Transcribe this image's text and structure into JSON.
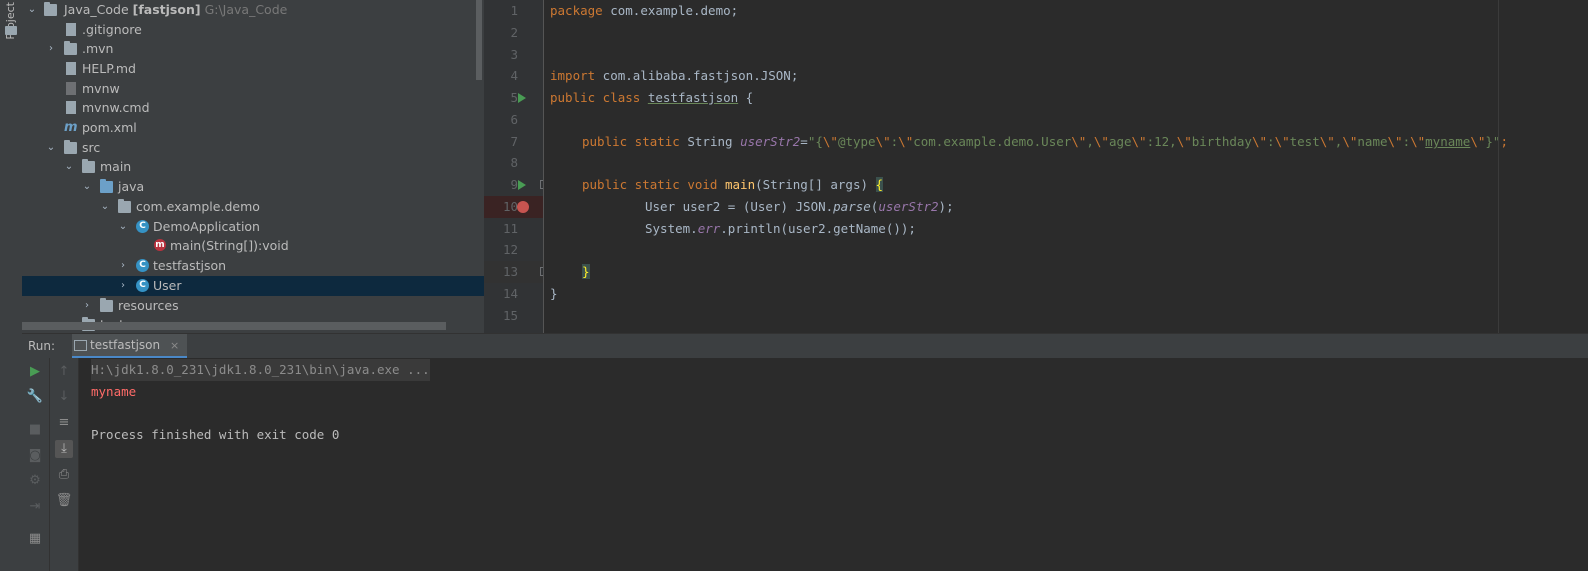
{
  "project_panel": {
    "stripe_label": "Project",
    "root_name": "Java_Code",
    "root_module": "[fastjson]",
    "root_path": "G:\\Java_Code",
    "items": [
      {
        "label": "Java_Code",
        "icon": "folder-icon"
      },
      {
        "label": ".gitignore",
        "icon": "ignore-file-icon"
      },
      {
        "label": ".mvn",
        "icon": "folder-icon"
      },
      {
        "label": "HELP.md",
        "icon": "markdown-file-icon"
      },
      {
        "label": "mvnw",
        "icon": "script-file-icon"
      },
      {
        "label": "mvnw.cmd",
        "icon": "text-file-icon"
      },
      {
        "label": "pom.xml",
        "icon": "maven-icon"
      },
      {
        "label": "src",
        "icon": "folder-icon"
      },
      {
        "label": "main",
        "icon": "folder-icon"
      },
      {
        "label": "java",
        "icon": "source-folder-icon"
      },
      {
        "label": "com.example.demo",
        "icon": "package-icon"
      },
      {
        "label": "DemoApplication",
        "icon": "spring-class-icon"
      },
      {
        "label": "main(String[]):void",
        "icon": "method-icon"
      },
      {
        "label": "testfastjson",
        "icon": "class-icon"
      },
      {
        "label": "User",
        "icon": "class-icon"
      },
      {
        "label": "resources",
        "icon": "resources-folder-icon"
      },
      {
        "label": "test",
        "icon": "folder-icon"
      }
    ]
  },
  "editor": {
    "line_numbers": [
      "1",
      "2",
      "3",
      "4",
      "5",
      "6",
      "7",
      "8",
      "9",
      "10",
      "11",
      "12",
      "13",
      "14",
      "15"
    ],
    "lines": {
      "l1_kw": "package",
      "l1_rest": " com.example.demo;",
      "l4_kw": "import",
      "l4_rest": " com.alibaba.fastjson.JSON;",
      "l5_kw": "public class",
      "l5_name": "testfastjson",
      "l5_rest": " {",
      "l7_kw": "public static",
      "l7_type": " String ",
      "l7_field": "userStr2",
      "l7_eq": "=",
      "l7_s1": "\"{",
      "l7_e1": "\\\"",
      "l7_s2": "@type",
      "l7_e2": "\\\"",
      "l7_s3": ":",
      "l7_e3": "\\\"",
      "l7_s4": "com.example.demo.User",
      "l7_e4": "\\\"",
      "l7_s5": ",",
      "l7_e5": "\\\"",
      "l7_s6": "age",
      "l7_e6": "\\\"",
      "l7_s7": ":12,",
      "l7_e7": "\\\"",
      "l7_s8": "birthday",
      "l7_e8": "\\\"",
      "l7_s9": ":",
      "l7_e9": "\\\"",
      "l7_s10": "test",
      "l7_e10": "\\\"",
      "l7_s11": ",",
      "l7_e11": "\\\"",
      "l7_s12": "name",
      "l7_e12": "\\\"",
      "l7_s13": ":",
      "l7_e13": "\\\"",
      "l7_s14": "myname",
      "l7_e14": "\\\"",
      "l7_s15": "}\"",
      "l7_end": ";",
      "l9_kw": "public static void",
      "l9_fn": "main",
      "l9_rest": "(String[] args) ",
      "l9_brace": "{",
      "l10_a": "User user2 = (User) JSON.",
      "l10_parse": "parse",
      "l10_b": "(",
      "l10_field": "userStr2",
      "l10_c": ");",
      "l11_a": "System.",
      "l11_err": "err",
      "l11_b": ".println(user2.getName());",
      "l13_brace": "}",
      "l14_brace": "}"
    }
  },
  "run_panel": {
    "title": "Run:",
    "tab_label": "testfastjson",
    "tab_close": "×",
    "output": [
      "H:\\jdk1.8.0_231\\jdk1.8.0_231\\bin\\java.exe ...",
      "myname",
      "",
      "Process finished with exit code 0"
    ]
  },
  "colors": {
    "keyword": "#cc7832",
    "string": "#6a8759",
    "field": "#9876aa",
    "function": "#ffc66d",
    "selection": "#0d293e",
    "breakpoint": "#c75450",
    "stderr": "#ff6b68"
  }
}
